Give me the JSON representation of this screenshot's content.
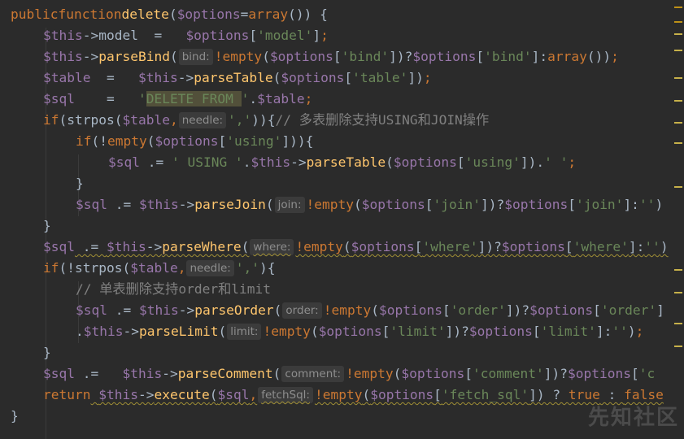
{
  "editor": {
    "lines": [
      "public function delete($options=array()) {",
      "$this->model  =   $options['model'];",
      "$this->parseBind( bind: !empty($options['bind'])?$options['bind']:array());",
      "$table  =   $this->parseTable($options['table']);",
      "$sql    =   'DELETE FROM '.$table;",
      "if(strpos($table, needle: ',')){// 多表删除支持USING和JOIN操作",
      "if(!empty($options['using'])){",
      "$sql .= ' USING '.$this->parseTable($options['using']).' ';",
      "}",
      "$sql .= $this->parseJoin( join: !empty($options['join'])?$options['join']:'')",
      "}",
      "$sql .= $this->parseWhere( where: !empty($options['where'])?$options['where']:'')",
      "if(!strpos($table, needle: ',')){",
      "// 单表删除支持order和limit",
      "$sql .= $this->parseOrder( order: !empty($options['order'])?$options['order']",
      ".$this->parseLimit( limit: !empty($options['limit'])?$options['limit']:'');",
      "}",
      "$sql .=   $this->parseComment( comment: !empty($options['comment'])?$options['c",
      "return $this->execute($sql, fetchSql: !empty($options['fetch_sql']) ? true : false",
      "}"
    ],
    "tokens": {
      "l0": [
        "public",
        "function",
        "delete",
        "(",
        "$options",
        "=",
        "array",
        "()) {"
      ],
      "l1": [
        "$this",
        "->model  =   ",
        "$options",
        "[",
        "'model'",
        "];"
      ],
      "l2": [
        "$this",
        "->",
        "parseBind",
        "(",
        "bind:",
        "!empty",
        "(",
        "$options",
        "[",
        "'bind'",
        "])?",
        "$options",
        "[",
        "'bind'",
        "]:",
        "array",
        "());"
      ],
      "l3": [
        "$table",
        "  =   ",
        "$this",
        "->",
        "parseTable",
        "(",
        "$options",
        "[",
        "'table'",
        "]);"
      ],
      "l4": [
        "$sql",
        "    =   ",
        "'",
        "DELETE FROM ",
        "'",
        ".",
        "$table",
        ";"
      ],
      "l5": [
        "if",
        "(strpos(",
        "$table",
        ",",
        "needle:",
        "','",
        ")){",
        "// 多表删除支持USING和JOIN操作"
      ],
      "l6": [
        "if",
        "(!",
        "empty",
        "(",
        "$options",
        "[",
        "'using'",
        "])){"
      ],
      "l7": [
        "$sql",
        " .= ",
        "' USING '",
        ".",
        "$this",
        "->",
        "parseTable",
        "(",
        "$options",
        "[",
        "'using'",
        "]).",
        "' '",
        ";"
      ],
      "l8": [
        "}"
      ],
      "l9": [
        "$sql",
        " .= ",
        "$this",
        "->",
        "parseJoin",
        "(",
        "join:",
        "!empty",
        "(",
        "$options",
        "[",
        "'join'",
        "])?",
        "$options",
        "[",
        "'join'",
        "]:",
        "''",
        ")"
      ],
      "l10": [
        "}"
      ],
      "l11": [
        "$sql",
        " .= ",
        "$this",
        "->",
        "parseWhere",
        "(",
        "where:",
        "!empty",
        "(",
        "$options",
        "[",
        "'where'",
        "])?",
        "$options",
        "[",
        "'where'",
        "]:",
        "''",
        ")"
      ],
      "l12": [
        "if",
        "(!strpos(",
        "$table",
        ",",
        "needle:",
        "','",
        "",
        "){"
      ],
      "l13": [
        "// 单表删除支持order和limit"
      ],
      "l14": [
        "$sql",
        " .= ",
        "$this",
        "->",
        "parseOrder",
        "(",
        "order:",
        "!empty",
        "(",
        "$options",
        "[",
        "'order'",
        "])?",
        "$options",
        "[",
        "'order'",
        "]"
      ],
      "l15": [
        ".",
        "$this",
        "->",
        "parseLimit",
        "(",
        "limit:",
        "!empty",
        "(",
        "$options",
        "[",
        "'limit'",
        "])?",
        "$options",
        "[",
        "'limit'",
        "]:",
        "''",
        ");"
      ],
      "l16": [
        "}"
      ],
      "l17": [
        "$sql",
        " .=   ",
        "$this",
        "->",
        "parseComment",
        "(",
        "comment:",
        "!empty",
        "(",
        "$options",
        "[",
        "'comment'",
        "])?",
        "$options",
        "[",
        "'c"
      ],
      "l18": [
        "return",
        " ",
        "$this",
        "->",
        "execute",
        "(",
        "$sql",
        ",",
        "fetchSql:",
        "!empty",
        "(",
        "$options",
        "[",
        "'fetch_sql'",
        "]) ? ",
        "true",
        " : ",
        "false"
      ],
      "l19": [
        "}"
      ]
    }
  },
  "watermark": "先知社区",
  "colors": {
    "background": "#2b2b2b",
    "keyword": "#cc7832",
    "variable": "#9876aa",
    "function": "#ffc66d",
    "string": "#6a8759",
    "comment": "#808080",
    "hint_bg": "#3b3b3b",
    "stripe_orange": "#be9117",
    "stripe_yellow": "#c7b14a"
  }
}
